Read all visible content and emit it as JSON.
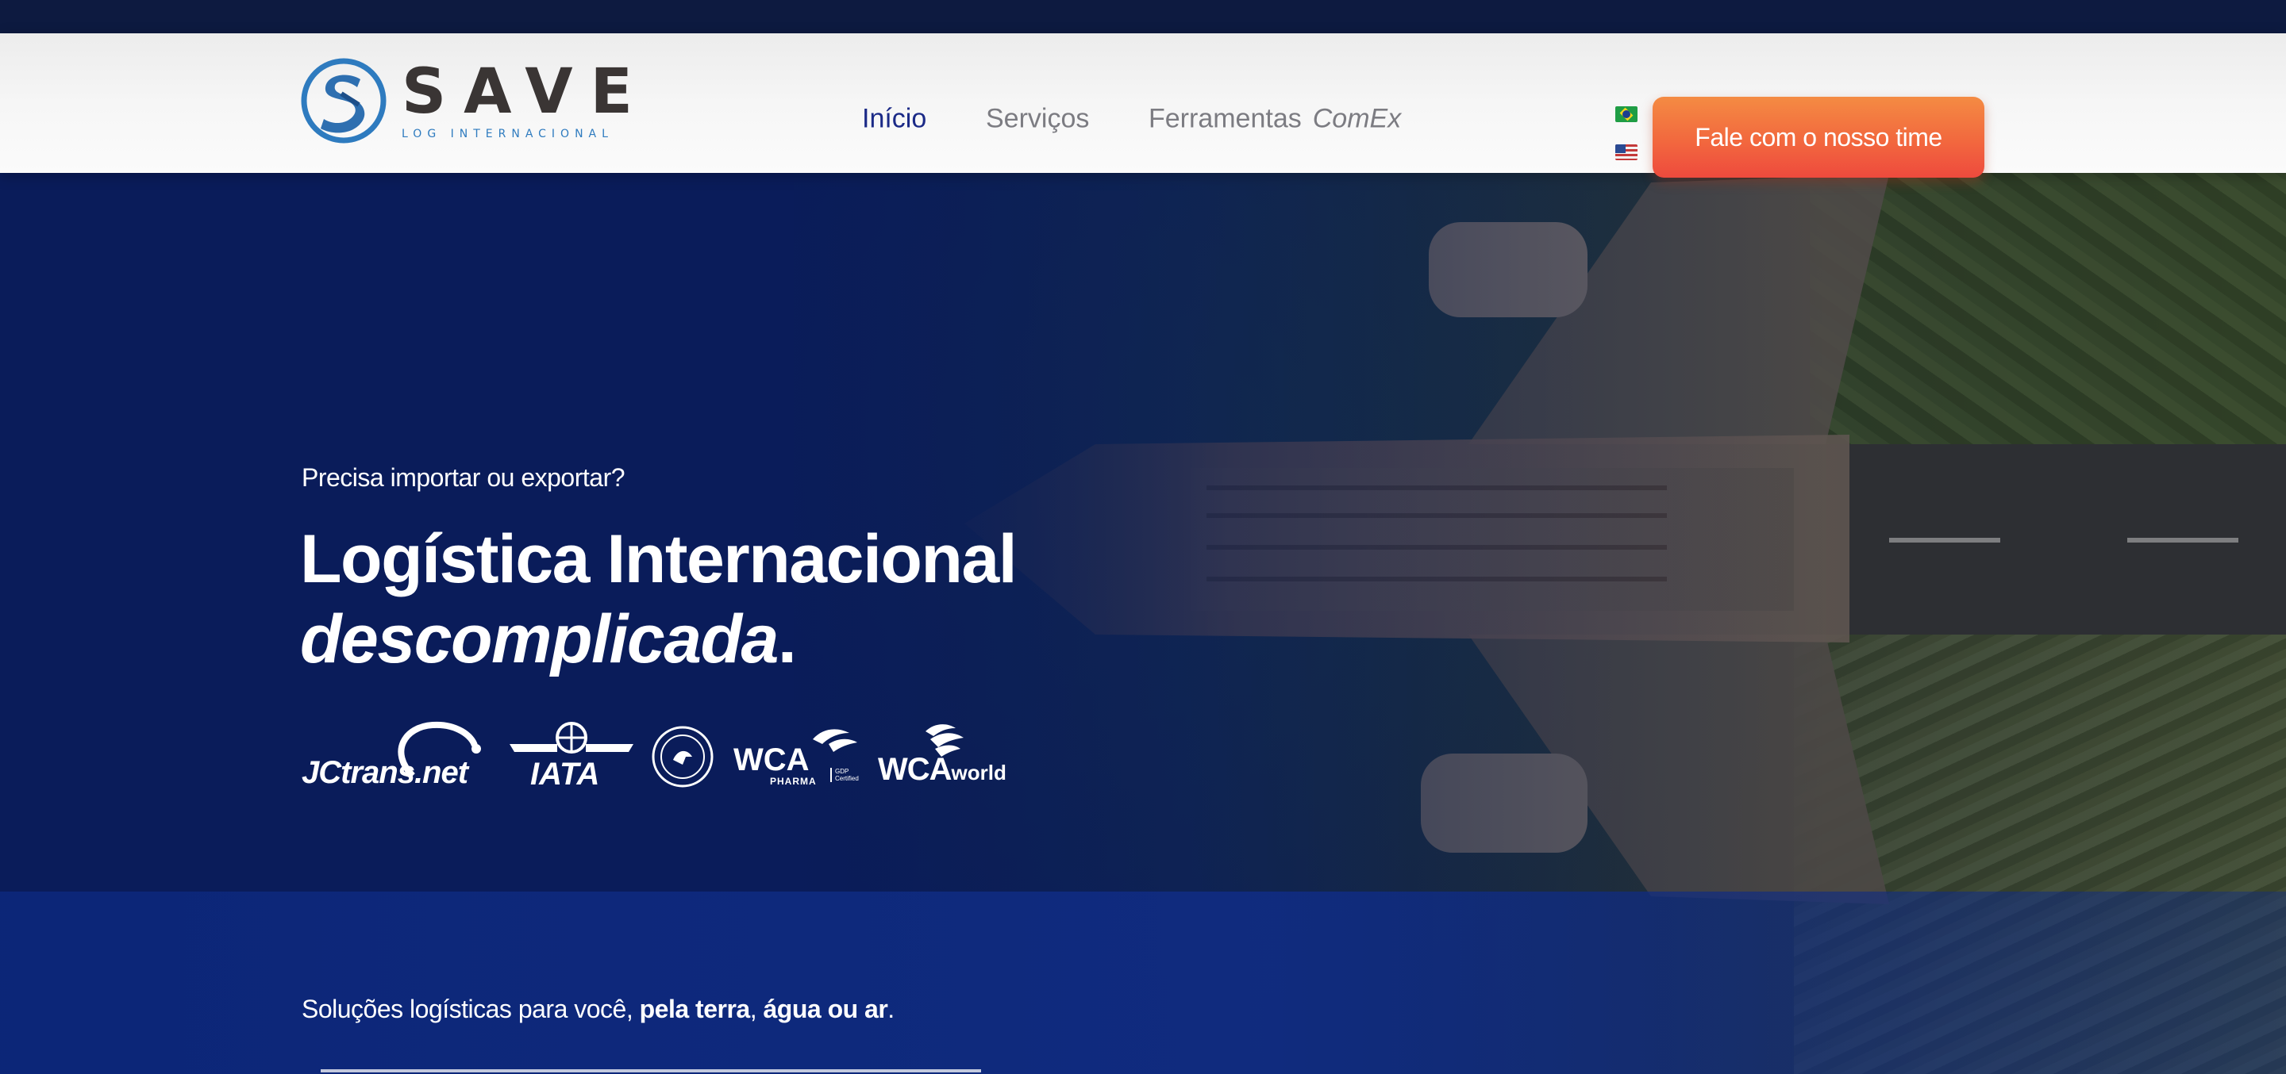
{
  "header": {
    "logo": {
      "name": "SAVE",
      "subtitle": "LOG INTERNACIONAL"
    },
    "nav": [
      {
        "label": "Início",
        "active": true
      },
      {
        "label": "Serviços",
        "active": false
      },
      {
        "label": "Ferramentas",
        "suffix": "ComEx",
        "active": false
      }
    ],
    "languages": [
      {
        "icon": "flag-brazil-icon"
      },
      {
        "icon": "flag-usa-icon"
      }
    ],
    "cta_label": "Fale com o nosso time"
  },
  "hero": {
    "kicker": "Precisa importar ou exportar?",
    "title_line1": "Logística Internacional",
    "title_emph": "descomplicada",
    "title_end": ".",
    "partners": [
      {
        "name": "JCtrans.net"
      },
      {
        "name": "IATA"
      },
      {
        "name": "certification seal"
      },
      {
        "name": "WCA",
        "sub": "PHARMA",
        "extra": "GDP Certified"
      },
      {
        "name": "WCA",
        "suffix": "world"
      }
    ]
  },
  "strip": {
    "text_start": "Soluções logísticas para você, ",
    "bold1": "pela terra",
    "sep": ", ",
    "bold2": "água ou ar",
    "text_end": "."
  },
  "colors": {
    "brand_blue": "#1b2a87",
    "cta_orange": "#f26b3e",
    "hero_navy": "#0a1c57"
  }
}
